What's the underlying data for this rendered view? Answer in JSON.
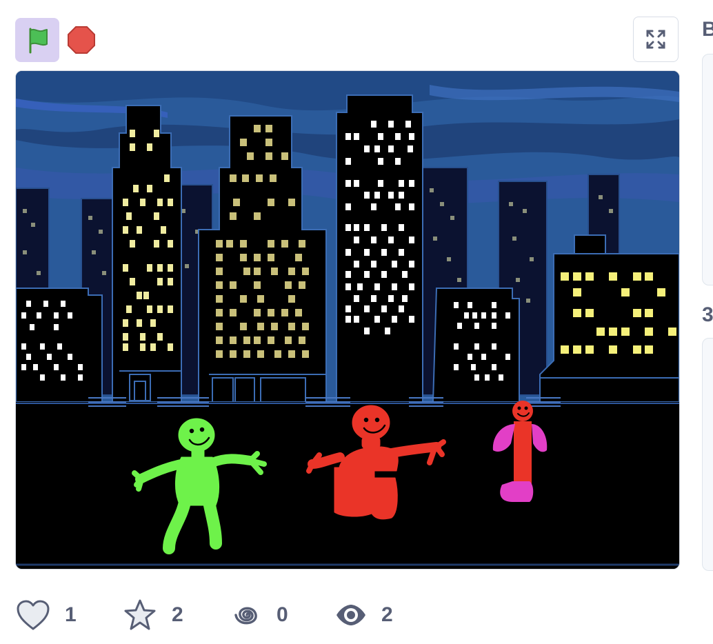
{
  "controls": {
    "green_flag_icon": "green-flag-icon",
    "stop_icon": "stop-sign-icon",
    "fullscreen_icon": "fullscreen-icon"
  },
  "stage": {
    "scene": "night-city-skyline",
    "sprites": [
      "green-figure",
      "red-figure",
      "red-pink-figure"
    ]
  },
  "side_panel": {
    "heading_letter": "B",
    "second_letter": "3"
  },
  "stats": {
    "loves": "1",
    "favorites": "2",
    "remixes": "0",
    "views": "2"
  },
  "colors": {
    "accent": "#855cd6",
    "flag_bg": "#d9d0f2",
    "text": "#575e75",
    "stop": "#e5534b",
    "sky": "#2a5a9a"
  }
}
